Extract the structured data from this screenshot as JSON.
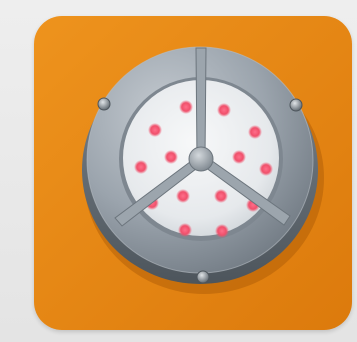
{
  "image": {
    "subject": "round-led-light-fixture-icon",
    "colors": {
      "background": "#e6e6e6",
      "tile": "#e98a16",
      "tile_dark": "#d8780c",
      "metal": "#9aa3ab",
      "lens": "#eef0f1",
      "led": "#f3506c"
    }
  }
}
